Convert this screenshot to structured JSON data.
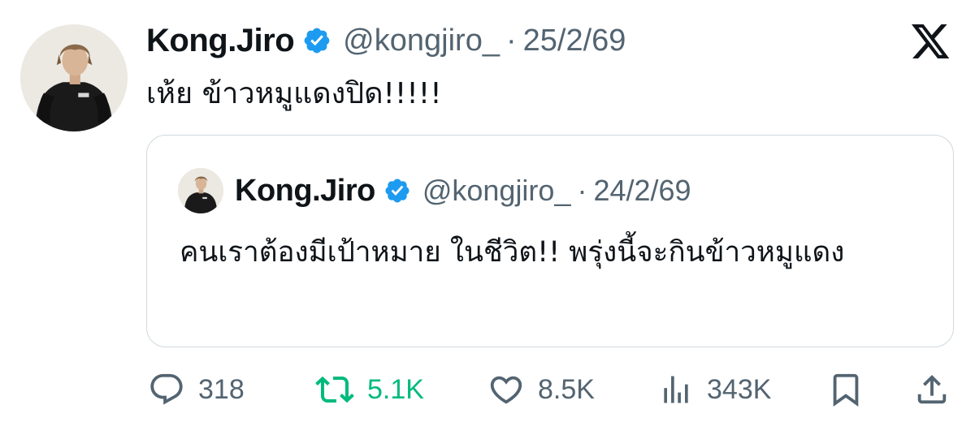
{
  "tweet": {
    "author": {
      "name": "Kong.Jiro",
      "handle": "@kongjiro_",
      "verified": true,
      "avatar": "avatar-person-black-jacket"
    },
    "separator": "·",
    "date": "25/2/69",
    "text": "เห้ย ข้าวหมูแดงปิด!!!!!"
  },
  "quoted_tweet": {
    "author": {
      "name": "Kong.Jiro",
      "handle": "@kongjiro_",
      "verified": true,
      "avatar": "avatar-person-black-jacket"
    },
    "separator": "·",
    "date": "24/2/69",
    "text": "คนเราต้องมีเป้าหมาย ในชีวิต!! พรุ่งนี้จะกินข้าวหมูแดง"
  },
  "actions": {
    "replies": "318",
    "retweets": "5.1K",
    "likes": "8.5K",
    "views": "343K"
  },
  "icons": {
    "verified": "verified-badge-icon",
    "logo": "x-logo-icon",
    "reply": "reply-icon",
    "retweet": "retweet-icon",
    "like": "like-icon",
    "views": "views-icon",
    "bookmark": "bookmark-icon",
    "share": "share-icon"
  },
  "colors": {
    "verified": "#1d9bf0",
    "text": "#0f1419",
    "secondary": "#536471",
    "retweet": "#00ba7c",
    "border": "#cfd9de"
  }
}
